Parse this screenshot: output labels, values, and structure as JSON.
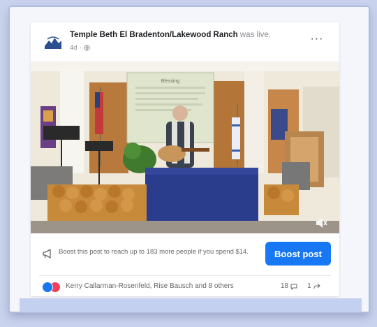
{
  "post": {
    "page_name": "Temple Beth El Bradenton/Lakewood Ranch",
    "status_text": "was live.",
    "time": "4d",
    "privacy_icon": "globe-icon",
    "more_icon": "more-options-icon",
    "more_label": "···"
  },
  "video": {
    "screen_text": "Blessing",
    "mute_icon": "speaker-icon"
  },
  "boost": {
    "message": "Boost this post to reach up to 183 more people if you spend $14.",
    "button_label": "Boost post",
    "icon": "megaphone-icon"
  },
  "reactions": {
    "types": [
      "like",
      "love"
    ],
    "names": "Kerry Callarman-Rosenfeld, Rise Bausch and 8 others",
    "comments_count": "18",
    "shares_count": "1"
  },
  "colors": {
    "accent": "#1877f2",
    "love": "#f33e58",
    "background": "#c9d3ee"
  }
}
